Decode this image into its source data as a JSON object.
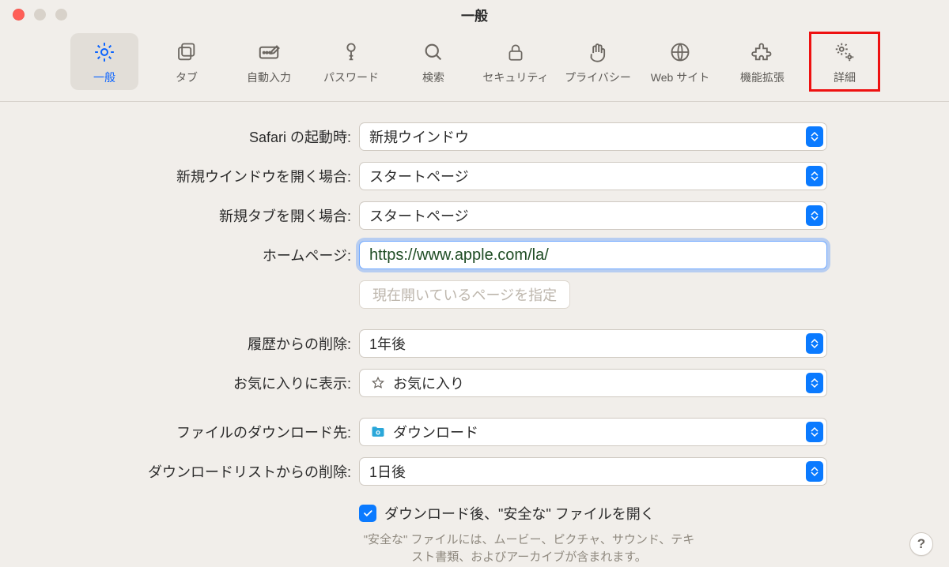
{
  "window": {
    "title": "一般"
  },
  "toolbar": {
    "items": [
      {
        "id": "general",
        "label": "一般",
        "icon": "gear-icon",
        "selected": true
      },
      {
        "id": "tabs",
        "label": "タブ",
        "icon": "copy-icon",
        "selected": false
      },
      {
        "id": "autofill",
        "label": "自動入力",
        "icon": "pencil-box-icon",
        "selected": false
      },
      {
        "id": "passwords",
        "label": "パスワード",
        "icon": "key-icon",
        "selected": false
      },
      {
        "id": "search",
        "label": "検索",
        "icon": "search-icon",
        "selected": false
      },
      {
        "id": "security",
        "label": "セキュリティ",
        "icon": "lock-icon",
        "selected": false
      },
      {
        "id": "privacy",
        "label": "プライバシー",
        "icon": "hand-icon",
        "selected": false
      },
      {
        "id": "websites",
        "label": "Web サイト",
        "icon": "globe-icon",
        "selected": false
      },
      {
        "id": "extensions",
        "label": "機能拡張",
        "icon": "puzzle-icon",
        "selected": false
      },
      {
        "id": "advanced",
        "label": "詳細",
        "icon": "gears-icon",
        "selected": false,
        "highlighted": true
      }
    ]
  },
  "form": {
    "launch": {
      "label": "Safari の起動時:",
      "value": "新規ウインドウ"
    },
    "new_window": {
      "label": "新規ウインドウを開く場合:",
      "value": "スタートページ"
    },
    "new_tab": {
      "label": "新規タブを開く場合:",
      "value": "スタートページ"
    },
    "homepage": {
      "label": "ホームページ:",
      "value": "https://www.apple.com/la/"
    },
    "set_homepage_btn": "現在開いているページを指定",
    "remove_history": {
      "label": "履歴からの削除:",
      "value": "1年後"
    },
    "favorites": {
      "label": "お気に入りに表示:",
      "value": "お気に入り"
    },
    "download_dest": {
      "label": "ファイルのダウンロード先:",
      "value": "ダウンロード"
    },
    "download_remove": {
      "label": "ダウンロードリストからの削除:",
      "value": "1日後"
    },
    "open_safe": {
      "checked": true,
      "label": "ダウンロード後、\"安全な\" ファイルを開く"
    },
    "open_safe_hint": "\"安全な\" ファイルには、ムービー、ピクチャ、サウンド、テキスト書類、およびアーカイブが含まれます。"
  },
  "help_button": "?"
}
